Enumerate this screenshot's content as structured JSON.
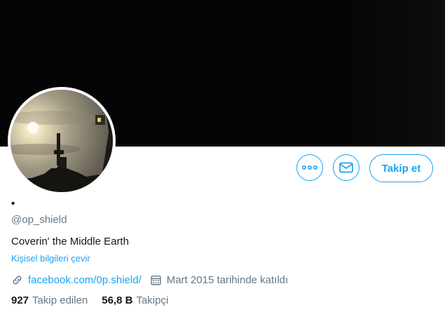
{
  "profile": {
    "display_name": "•",
    "handle": "@op_shield",
    "bio": "Coverin' the Middle Earth",
    "translate_label": "Kişisel bilgileri çevir",
    "website": "facebook.com/0p.shield/",
    "joined": "Mart 2015 tarihinde katıldı",
    "following_count": "927",
    "following_label": "Takip edilen",
    "followers_count": "56,8 B",
    "followers_label": "Takipçi"
  },
  "actions": {
    "follow_label": "Takip et",
    "more_icon": "more-icon",
    "message_icon": "mail-icon"
  },
  "colors": {
    "accent": "#1da1f2",
    "banner": "#050505",
    "secondary_text": "#657786"
  }
}
